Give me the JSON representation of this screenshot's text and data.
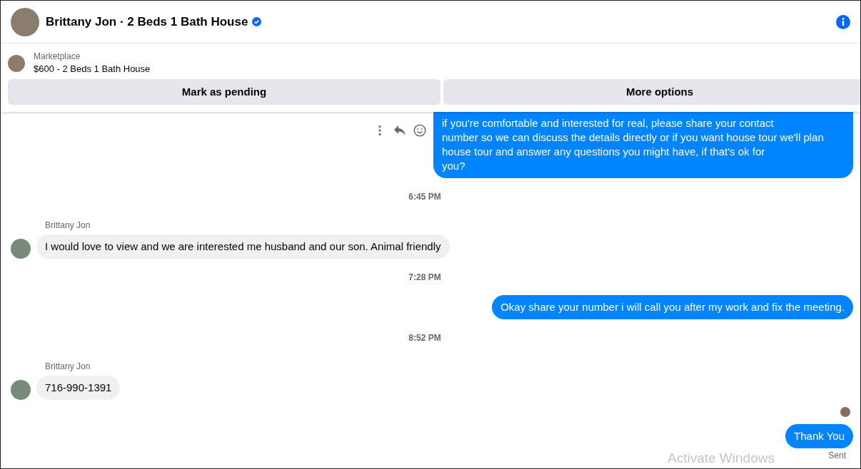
{
  "header": {
    "title": "Brittany Jon · 2 Beds 1 Bath House",
    "verified": true
  },
  "listing": {
    "source": "Marketplace",
    "title": "$600 - 2 Beds 1 Bath House"
  },
  "buttons": [
    "Mark as pending",
    "More options"
  ],
  "messages": [
    {
      "kind": "outgoing",
      "text": "if you're comfortable and interested for real, please share your contact\nnumber so we can discuss the details directly or if you want house tour we'll plan\nhouse tour and answer any questions you might have, if that's ok for\nyou?",
      "hovered": true
    },
    {
      "kind": "timestamp",
      "text": "6:45 PM"
    },
    {
      "kind": "incoming",
      "sender": "Brittany Jon",
      "text": "I would love to view and we are interested me husband and our son. Animal friendly"
    },
    {
      "kind": "timestamp",
      "text": "7:28 PM"
    },
    {
      "kind": "outgoing",
      "text": "Okay share your number i will call you after my work and fix the meeting.",
      "hovered": false
    },
    {
      "kind": "timestamp",
      "text": "8:52 PM"
    },
    {
      "kind": "incoming",
      "sender": "Brittany Jon",
      "text": "716-990-1391"
    },
    {
      "kind": "seen"
    },
    {
      "kind": "outgoing",
      "text": "Thank You",
      "hovered": false,
      "status": "Sent"
    }
  ],
  "os_overlay": {
    "text": "Activate Windows"
  }
}
